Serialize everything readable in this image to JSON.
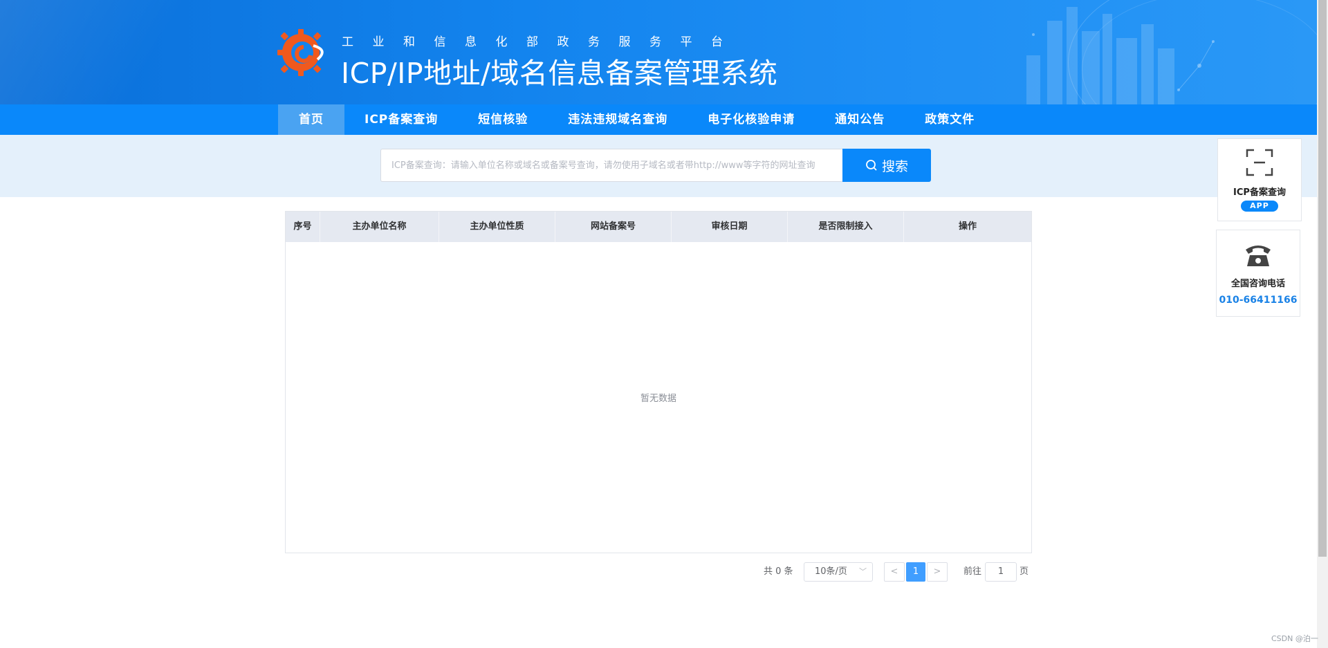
{
  "header": {
    "subtitle": "工业和信息化部政务服务平台",
    "title": "ICP/IP地址/域名信息备案管理系统"
  },
  "nav": {
    "items": [
      {
        "label": "首页",
        "active": true
      },
      {
        "label": "ICP备案查询",
        "active": false
      },
      {
        "label": "短信核验",
        "active": false
      },
      {
        "label": "违法违规域名查询",
        "active": false
      },
      {
        "label": "电子化核验申请",
        "active": false
      },
      {
        "label": "通知公告",
        "active": false
      },
      {
        "label": "政策文件",
        "active": false
      }
    ]
  },
  "search": {
    "placeholder": "ICP备案查询：请输入单位名称或域名或备案号查询，请勿使用子域名或者带http://www等字符的网址查询",
    "value": "",
    "button_label": "搜索"
  },
  "table": {
    "columns": [
      "序号",
      "主办单位名称",
      "主办单位性质",
      "网站备案号",
      "审核日期",
      "是否限制接入",
      "操作"
    ],
    "rows": [],
    "empty_text": "暂无数据"
  },
  "pagination": {
    "total_text": "共 0 条",
    "page_size": "10条/页",
    "current_page": "1",
    "goto_label": "前往",
    "goto_value": "1",
    "page_suffix": "页"
  },
  "side": {
    "app_card": {
      "label": "ICP备案查询",
      "badge": "APP",
      "icon": "scan-icon"
    },
    "phone_card": {
      "label": "全国咨询电话",
      "number": "010-66411166",
      "icon": "telephone-icon"
    }
  },
  "watermark": "CSDN @泊一",
  "colors": {
    "primary": "#0a88fa",
    "nav_active": "#4aa3f2",
    "search_band": "#e4f0fb",
    "table_header": "#e5e9f1",
    "pager_active": "#409eff",
    "phone_text": "#1a82e6"
  }
}
